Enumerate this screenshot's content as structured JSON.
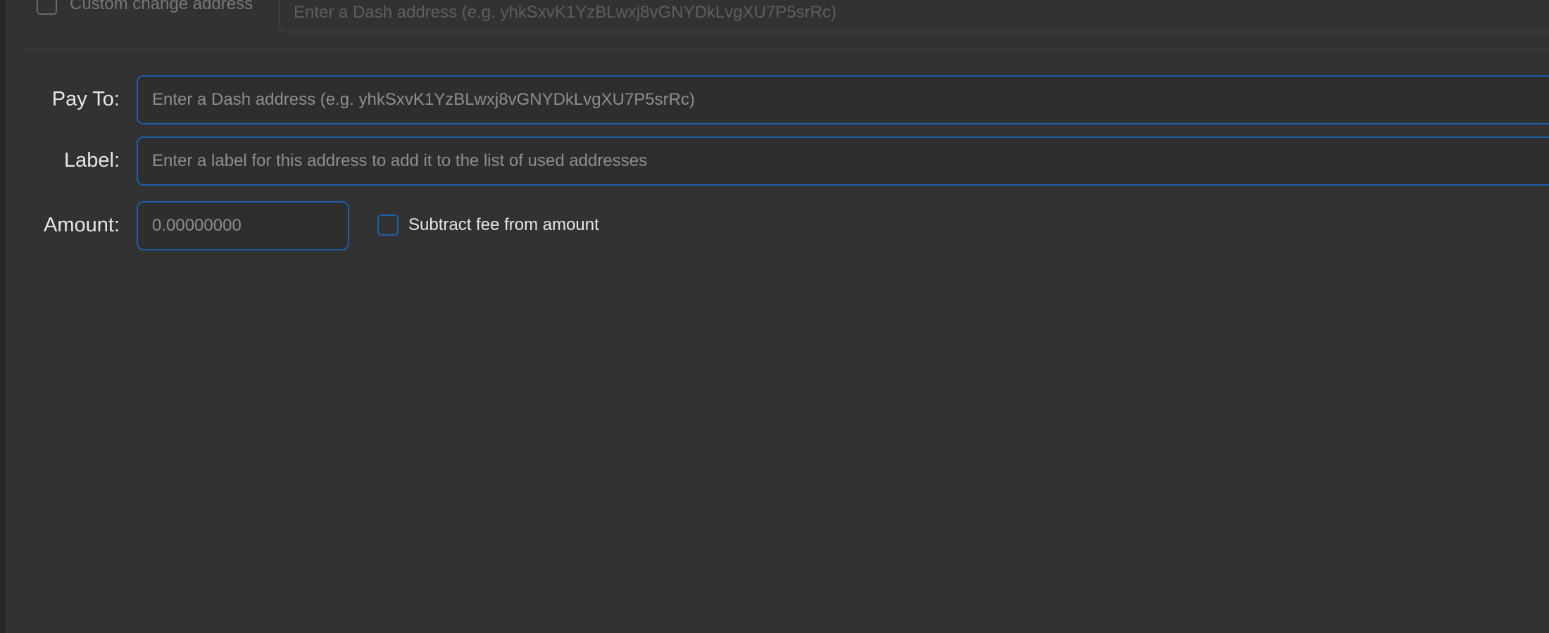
{
  "change": {
    "checkbox_label": "Custom change address",
    "address_placeholder": "Enter a Dash address (e.g. yhkSxvK1YzBLwxj8vGNYDkLvgXU7P5srRc)"
  },
  "form": {
    "pay_to_label": "Pay To:",
    "pay_to_placeholder": "Enter a Dash address (e.g. yhkSxvK1YzBLwxj8vGNYDkLvgXU7P5srRc)",
    "label_label": "Label:",
    "label_placeholder": "Enter a label for this address to add it to the list of used addresses",
    "amount_label": "Amount:",
    "amount_placeholder": "0.00000000",
    "subtract_fee_label": "Subtract fee from amount"
  },
  "colors": {
    "accent": "#1d5fa8",
    "background": "#323232",
    "text": "#e6e6e6",
    "placeholder": "#8e8e8e"
  }
}
